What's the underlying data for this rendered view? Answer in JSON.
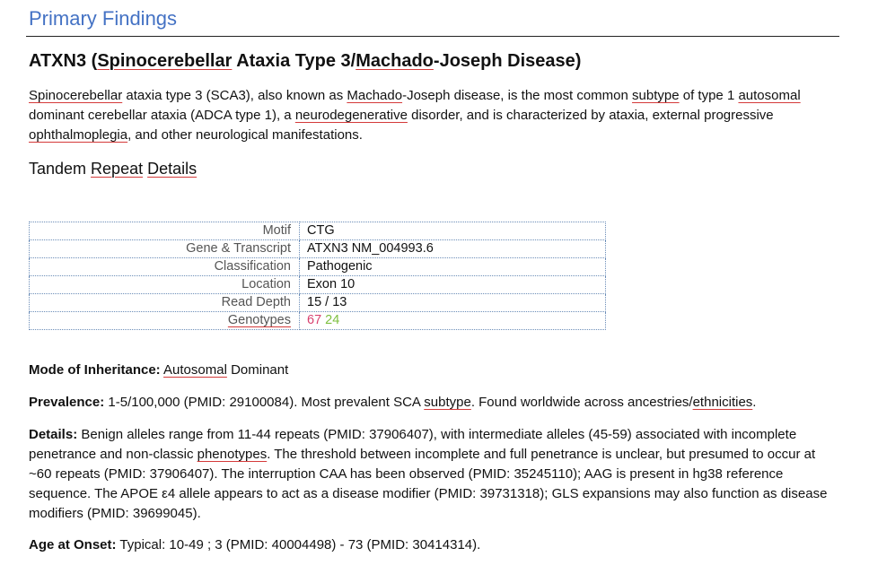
{
  "section_heading": "Primary Findings",
  "title": {
    "gene": "ATXN3 (",
    "sp1": "Spinocerebellar",
    "mid1": " Ataxia Type 3/",
    "sp2": "Machado",
    "rest": "-Joseph Disease)"
  },
  "intro": {
    "s1": "Spinocerebellar",
    "t1": " ataxia type 3 (SCA3), also known as ",
    "s2": "Machado",
    "t2": "-Joseph disease, is the most common ",
    "s3": "subtype",
    "t3": " of type 1 ",
    "s4": "autosomal",
    "t4": " dominant cerebellar ataxia (ADCA type 1), a ",
    "s5": "neurodegenerative",
    "t5": " disorder, and is characterized by ataxia, external progressive ",
    "s6": "ophthalmoplegia",
    "t6": ", and other neurological manifestations."
  },
  "subheading": {
    "t1": "Tandem ",
    "s1": "Repeat",
    "t2": " ",
    "s2": "Details"
  },
  "table": {
    "motif_label": "Motif",
    "motif_value": "CTG",
    "gene_label": "Gene & Transcript",
    "gene_value": "ATXN3 NM_004993.6",
    "class_label": "Classification",
    "class_value": "Pathogenic",
    "location_label": "Location",
    "location_value": "Exon 10",
    "depth_label": "Read Depth",
    "depth_value": "15 / 13",
    "genotypes_label": "Genotypes",
    "genotype_1": "67",
    "genotype_2": "24"
  },
  "inheritance": {
    "label": "Mode of Inheritance:",
    "sp": "Autosomal",
    "rest": " Dominant"
  },
  "prevalence": {
    "label": "Prevalence:",
    "t1": " 1-5/100,000 (PMID: 29100084). Most prevalent SCA ",
    "s1": "subtype",
    "t2": ". Found worldwide across ancestries/",
    "s2": "ethnicities",
    "t3": "."
  },
  "details": {
    "label": "Details:",
    "t1": " Benign alleles range from 11-44 repeats (PMID: 37906407), with intermediate alleles (45-59) associated with incomplete penetrance and non-classic ",
    "s1": "phenotypes",
    "t2": ". The threshold between incomplete and full penetrance is unclear, but presumed to occur at ~60 repeats (PMID: 37906407). The interruption CAA has been observed (PMID: 35245110); AAG is present in hg38 reference sequence. The APOE ε4 allele appears to act as a disease modifier (PMID: 39731318); GLS expansions may also function as disease modifiers (PMID: 39699045)."
  },
  "onset": {
    "label": "Age at Onset:",
    "text": " Typical: 10-49 ; 3 (PMID: 40004498) - 73 (PMID: 30414314)."
  },
  "colors": {
    "heading": "#4472c4",
    "pathogenic": "#d9416f",
    "genotype_2": "#7dbf3f",
    "spell_underline": "#d43a3a"
  }
}
